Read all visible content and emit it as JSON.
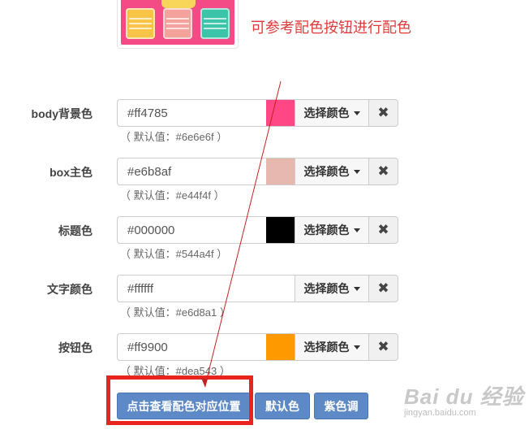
{
  "hint": "可参考配色按钮进行配色",
  "rows": [
    {
      "label": "body背景色",
      "value": "#ff4785",
      "swatch": "#ff4785",
      "pick": "选择颜色",
      "default": "（ 默认值：#6e6e6f ）"
    },
    {
      "label": "box主色",
      "value": "#e6b8af",
      "swatch": "#e6b8af",
      "pick": "选择颜色",
      "default": "（ 默认值：#e44f4f ）"
    },
    {
      "label": "标题色",
      "value": "#000000",
      "swatch": "#000000",
      "pick": "选择颜色",
      "default": "（ 默认值：#544a4f ）"
    },
    {
      "label": "文字颜色",
      "value": "#ffffff",
      "swatch": "#ffffff",
      "pick": "选择颜色",
      "default": "（ 默认值：#e6d8a1 ）"
    },
    {
      "label": "按钮色",
      "value": "#ff9900",
      "swatch": "#ff9900",
      "pick": "选择颜色",
      "default": "（ 默认值：#dea543 ）"
    }
  ],
  "buttons": {
    "view_position": "点击查看配色对应位置",
    "default_color": "默认色",
    "purple": "紫色调"
  },
  "watermark": {
    "logo": "Bai du 经验",
    "sub": "jingyan.baidu.com"
  },
  "colors": {
    "accent_button": "#5d89c6",
    "highlight_box": "#e8241f",
    "hint_text": "#e23a3a"
  },
  "icons": {
    "clear": "close-icon",
    "dropdown": "caret-down-icon"
  }
}
